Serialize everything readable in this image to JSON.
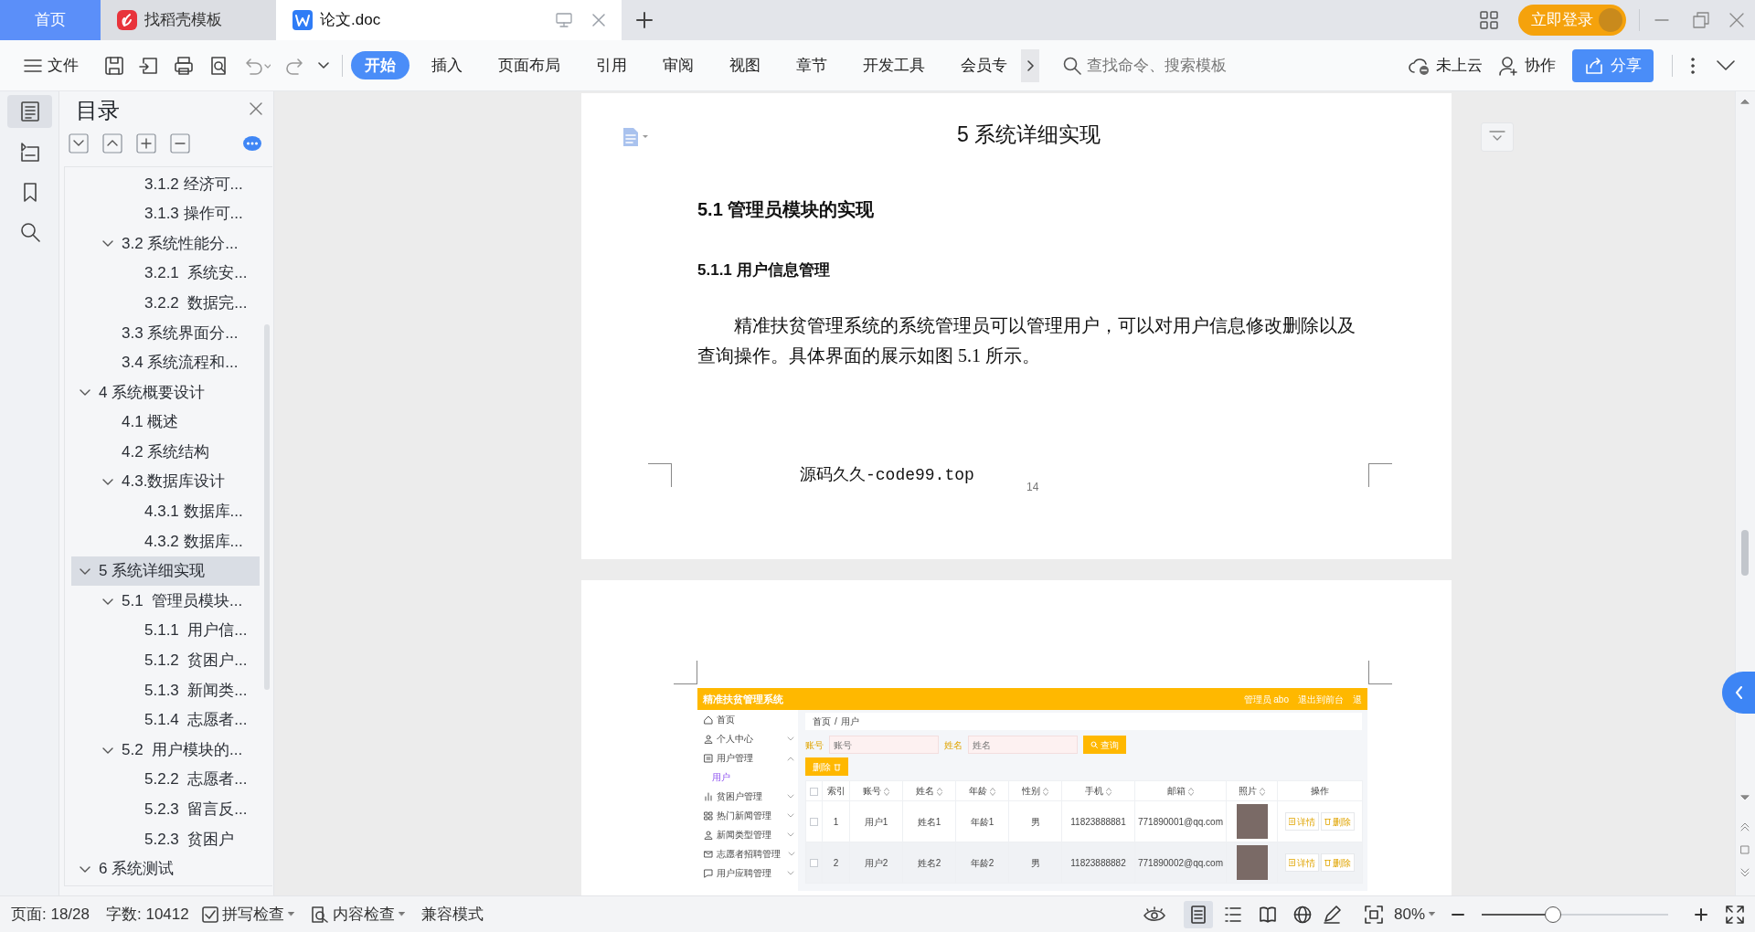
{
  "tabs": [
    {
      "label": "首页",
      "kind": "home",
      "selected": false
    },
    {
      "label": "找稻壳模板",
      "kind": "template",
      "selected": false
    },
    {
      "label": "论文.doc",
      "kind": "doc",
      "selected": true
    }
  ],
  "login_button": "立即登录",
  "file_menu": "文件",
  "ribbon_tabs": [
    {
      "label": "开始",
      "selected": true
    },
    {
      "label": "插入",
      "selected": false
    },
    {
      "label": "页面布局",
      "selected": false
    },
    {
      "label": "引用",
      "selected": false
    },
    {
      "label": "审阅",
      "selected": false
    },
    {
      "label": "视图",
      "selected": false
    },
    {
      "label": "章节",
      "selected": false
    },
    {
      "label": "开发工具",
      "selected": false
    },
    {
      "label": "会员专",
      "selected": false
    }
  ],
  "search": {
    "placeholder": "查找命令、搜索模板"
  },
  "cloud_status": "未上云",
  "collaborate": "协作",
  "share": "分享",
  "rail": [
    {
      "kind": "toc",
      "selected": true
    },
    {
      "kind": "navigation",
      "selected": false
    },
    {
      "kind": "bookmark",
      "selected": false
    },
    {
      "kind": "find",
      "selected": false
    }
  ],
  "toc": {
    "title": "目录",
    "items": [
      {
        "children": [
          {
            "children": [
              {
                "label": "3.1.2 经济可...",
                "selected": false
              },
              {
                "label": "3.1.3 操作可...",
                "selected": false
              }
            ]
          },
          {
            "label": "3.2 系统性能分...",
            "expanded": true,
            "selected": false,
            "children": [
              {
                "label": "3.2.1  系统安...",
                "selected": false
              },
              {
                "label": "3.2.2  数据完...",
                "selected": false
              }
            ]
          },
          {
            "label": "3.3 系统界面分...",
            "selected": false
          },
          {
            "label": "3.4 系统流程和...",
            "selected": false
          }
        ]
      },
      {
        "label": "4 系统概要设计",
        "expanded": true,
        "selected": false,
        "children": [
          {
            "label": "4.1 概述",
            "selected": false
          },
          {
            "label": "4.2 系统结构",
            "selected": false
          },
          {
            "label": "4.3.数据库设计",
            "expanded": true,
            "selected": false,
            "children": [
              {
                "label": "4.3.1 数据库...",
                "selected": false
              },
              {
                "label": "4.3.2 数据库...",
                "selected": false
              }
            ]
          }
        ]
      },
      {
        "label": "5 系统详细实现",
        "expanded": true,
        "selected": true,
        "children": [
          {
            "label": "5.1  管理员模块...",
            "expanded": true,
            "selected": false,
            "children": [
              {
                "label": "5.1.1  用户信...",
                "selected": false
              },
              {
                "label": "5.1.2  贫困户...",
                "selected": false
              },
              {
                "label": "5.1.3  新闻类...",
                "selected": false
              },
              {
                "label": "5.1.4  志愿者...",
                "selected": false
              }
            ]
          },
          {
            "label": "5.2  用户模块的...",
            "expanded": true,
            "selected": false,
            "children": [
              {
                "label": "5.2.2  志愿者...",
                "selected": false
              },
              {
                "label": "5.2.3  留言反...",
                "selected": false
              },
              {
                "label": "5.2.3  贫困户",
                "selected": false
              }
            ]
          }
        ]
      },
      {
        "label": "6 系统测试",
        "expanded": true,
        "selected": false
      }
    ]
  },
  "page_1": {
    "chapter_title": "5 系统详细实现",
    "section_title": "5.1  管理员模块的实现",
    "subsection_title": "5.1.1  用户信息管理",
    "paragraph": "精准扶贫管理系统的系统管理员可以管理用户，可以对用户信息修改删除以及查询操作。具体界面的展示如图 5.1 所示。",
    "footer_text": "源码久久-code99.top",
    "page_number": "14"
  },
  "page_2": {
    "figure": {
      "title": "精准扶贫管理系统",
      "user": "管理员 abo",
      "links": [
        "退出到前台",
        "退"
      ],
      "menu": [
        {
          "label": "首页",
          "kind": "home"
        },
        {
          "label": "个人中心",
          "kind": "user",
          "expanded": false
        },
        {
          "label": "用户管理",
          "kind": "list",
          "expanded": true,
          "children": [
            {
              "label": "用户",
              "selected": true
            }
          ]
        },
        {
          "label": "贫困户管理",
          "kind": "chart",
          "expanded": false
        },
        {
          "label": "热门新闻管理",
          "kind": "grid",
          "expanded": false
        },
        {
          "label": "新闻类型管理",
          "kind": "user",
          "expanded": false
        },
        {
          "label": "志愿者招聘管理",
          "kind": "mail",
          "expanded": false
        },
        {
          "label": "用户应聘管理",
          "kind": "chat",
          "expanded": false
        }
      ],
      "breadcrumb": {
        "items": [
          "首页",
          "用户"
        ],
        "separator": "/"
      },
      "filters": [
        {
          "label": "账号",
          "placeholder": "账号"
        },
        {
          "label": "姓名",
          "placeholder": "姓名"
        }
      ],
      "search_button": "查询",
      "delete_button": "删除",
      "all_checked": false,
      "columns": [
        {
          "label": "索引",
          "sortable": false
        },
        {
          "label": "账号",
          "sortable": true
        },
        {
          "label": "姓名",
          "sortable": true
        },
        {
          "label": "年龄",
          "sortable": true
        },
        {
          "label": "性别",
          "sortable": true
        },
        {
          "label": "手机",
          "sortable": true
        },
        {
          "label": "邮箱",
          "sortable": true
        },
        {
          "label": "照片",
          "sortable": true
        },
        {
          "label": "操作",
          "sortable": false
        }
      ],
      "rows": [
        {
          "checked": false,
          "cells": [
            "1",
            "用户1",
            "姓名1",
            "年龄1",
            "男",
            "11823888881",
            "771890001@qq.com"
          ],
          "actions": [
            {
              "label": "详情",
              "kind": "details"
            },
            {
              "label": "删除",
              "kind": "delete"
            }
          ]
        },
        {
          "checked": false,
          "cells": [
            "2",
            "用户2",
            "姓名2",
            "年龄2",
            "男",
            "11823888882",
            "771890002@qq.com"
          ],
          "actions": [
            {
              "label": "详情",
              "kind": "details"
            },
            {
              "label": "删除",
              "kind": "delete"
            }
          ]
        }
      ]
    }
  },
  "status_bar": {
    "page": "页面: 18/28",
    "word_count": "字数: 10412",
    "spell_check": "拼写检查",
    "content_check": "内容检查",
    "compat_mode": "兼容模式",
    "view_modes": [
      {
        "kind": "page",
        "selected": true
      },
      {
        "kind": "outline",
        "selected": false
      },
      {
        "kind": "reading",
        "selected": false
      },
      {
        "kind": "web",
        "selected": false
      }
    ],
    "zoom": "80%",
    "zoom_slider": {
      "level": 0.38
    }
  }
}
